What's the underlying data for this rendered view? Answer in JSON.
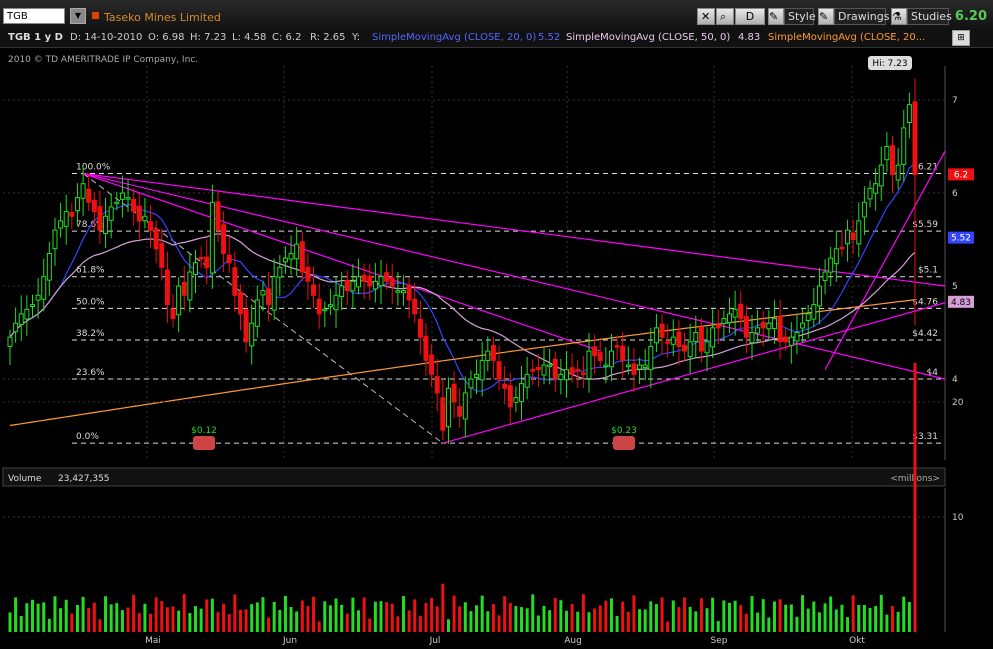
{
  "toolbar": {
    "symbol": "TGB",
    "company": "Taseko Mines Limited",
    "period_button": "D",
    "style_label": "Style",
    "drawings_label": "Drawings",
    "studies_label": "Studies",
    "last_price": "6.20"
  },
  "info": {
    "symbol_period": "TGB 1 y D",
    "date": "D: 14-10-2010",
    "open": "O: 6.98",
    "high": "H: 7.23",
    "low": "L: 4.58",
    "close": "C: 6.2",
    "range": "R: 2.65",
    "y": "Y:",
    "sma20_label": "SimpleMovingAvg (CLOSE, 20, 0)",
    "sma20_value": "5.52",
    "sma50_label": "SimpleMovingAvg (CLOSE, 50, 0)",
    "sma50_value": "4.83",
    "sma200_label": "SimpleMovingAvg (CLOSE, 20..."
  },
  "copyright": "2010 © TD AMERITRADE IP Company, Inc.",
  "hi_label": "Hi: 7.23",
  "volume_label": "Volume",
  "volume_value": "23,427,355",
  "volume_unit": "<millions>",
  "dividends": [
    "$0.12",
    "$0.23"
  ],
  "colors": {
    "up": "#22dd22",
    "down": "#ee1111",
    "sma20": "#3344ff",
    "sma50": "#ff9933",
    "sma200": "#d8a0d8",
    "trendline": "#ff00ff",
    "fib": "#dddddd"
  },
  "chart_data": {
    "type": "candlestick",
    "x_tick_labels": [
      "Mai",
      "Jun",
      "Jul",
      "Aug",
      "Sep",
      "Okt"
    ],
    "price_axis_ticks": [
      "7",
      "6",
      "5",
      "4"
    ],
    "price_axis_badges": [
      {
        "text": "6.2",
        "color": "#ee1111"
      },
      {
        "text": "5.52",
        "color": "#3344ff"
      },
      {
        "text": "4.83",
        "color": "#d8a0d8"
      }
    ],
    "fib_levels": [
      {
        "pct": "100.0%",
        "price": 6.21,
        "label": "$6.21"
      },
      {
        "pct": "78.6%",
        "price": 5.59,
        "label": "$5.59"
      },
      {
        "pct": "61.8%",
        "price": 5.1,
        "label": "$5.1"
      },
      {
        "pct": "50.0%",
        "price": 4.76,
        "label": "$4.76"
      },
      {
        "pct": "38.2%",
        "price": 4.42,
        "label": "$4.42"
      },
      {
        "pct": "23.6%",
        "price": 4.0,
        "label": "$4"
      },
      {
        "pct": "0.0%",
        "price": 3.31,
        "label": "$3.31"
      }
    ],
    "volume_ticks": [
      "20",
      "10"
    ],
    "close": [
      4.45,
      4.6,
      4.7,
      4.75,
      4.8,
      4.9,
      5.1,
      5.35,
      5.6,
      5.7,
      5.8,
      5.75,
      5.95,
      6.1,
      5.9,
      5.8,
      5.6,
      5.75,
      5.85,
      5.9,
      6.0,
      5.95,
      5.8,
      5.7,
      5.75,
      5.6,
      5.4,
      5.2,
      4.8,
      4.65,
      5.0,
      4.9,
      5.15,
      5.25,
      5.3,
      5.2,
      5.9,
      5.6,
      5.35,
      5.25,
      4.9,
      4.7,
      4.4,
      4.6,
      4.85,
      4.95,
      4.8,
      5.1,
      5.2,
      5.3,
      5.35,
      5.45,
      5.15,
      5.05,
      4.9,
      4.7,
      4.75,
      4.8,
      4.9,
      5.0,
      4.95,
      5.05,
      5.1,
      5.05,
      5.0,
      5.05,
      5.1,
      5.05,
      5.0,
      4.95,
      4.95,
      4.85,
      4.7,
      4.45,
      4.2,
      4.05,
      3.85,
      3.45,
      3.9,
      3.75,
      3.6,
      3.85,
      4.0,
      4.05,
      4.2,
      4.3,
      4.2,
      4.0,
      3.9,
      3.7,
      3.8,
      3.95,
      4.05,
      4.1,
      4.1,
      4.15,
      4.15,
      4.0,
      4.05,
      4.1,
      4.05,
      4.1,
      4.05,
      4.3,
      4.25,
      4.2,
      4.15,
      4.3,
      4.35,
      4.2,
      4.15,
      4.05,
      4.15,
      4.15,
      4.35,
      4.55,
      4.45,
      4.4,
      4.45,
      4.35,
      4.3,
      4.4,
      4.5,
      4.3,
      4.4,
      4.55,
      4.55,
      4.65,
      4.7,
      4.75,
      4.65,
      4.45,
      4.5,
      4.55,
      4.55,
      4.6,
      4.65,
      4.4,
      4.4,
      4.45,
      4.5,
      4.6,
      4.7,
      4.8,
      5.0,
      5.15,
      5.3,
      5.4,
      5.4,
      5.6,
      5.5,
      5.7,
      5.9,
      6.05,
      6.1,
      6.3,
      6.5,
      6.2,
      6.3,
      6.7,
      6.95,
      6.2
    ]
  }
}
